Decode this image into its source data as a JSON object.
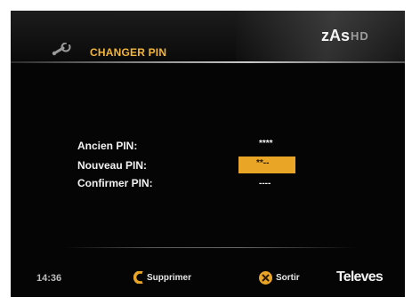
{
  "header": {
    "title": "CHANGER PIN",
    "brand": "zAs",
    "brand_suffix": "HD",
    "icon": "wrench-icon"
  },
  "form": {
    "fields": [
      {
        "label": "Ancien PIN:",
        "value": "****"
      },
      {
        "label": "Nouveau PIN:",
        "value": "**--"
      },
      {
        "label": "Confirmer PIN:",
        "value": "----"
      }
    ],
    "active_field_index": 1
  },
  "footer": {
    "time": "14:36",
    "delete_label": "Supprimer",
    "exit_label": "Sortir",
    "logo": "Televes"
  },
  "colors": {
    "accent": "#e9a526",
    "background": "#050505",
    "text": "#f2f2f2"
  }
}
